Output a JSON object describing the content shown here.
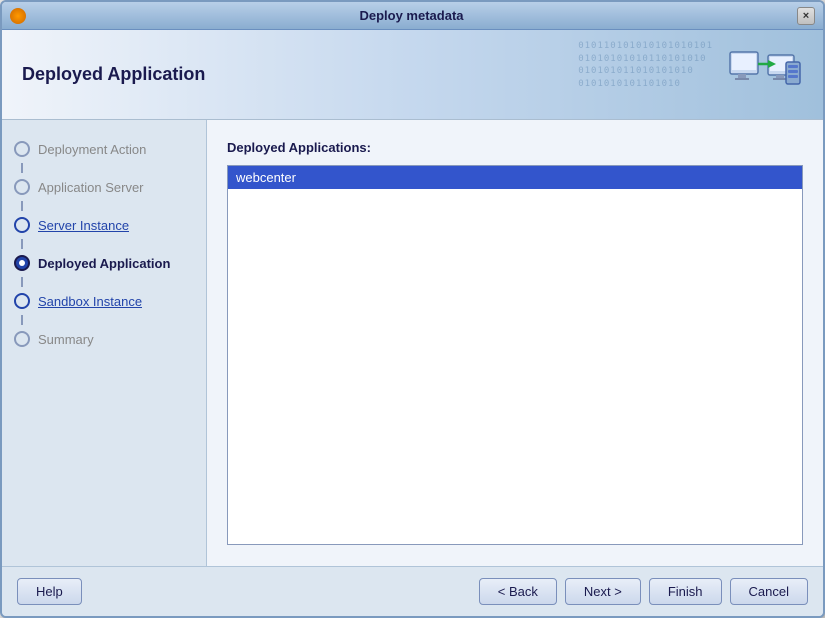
{
  "window": {
    "title": "Deploy metadata",
    "close_label": "×"
  },
  "header": {
    "title": "Deployed Application",
    "bg_text": "010110101010101010101\n01010101010110101010\n010101011010101010\n0101010101101010"
  },
  "sidebar": {
    "items": [
      {
        "id": "deployment-action",
        "label": "Deployment Action",
        "state": "disabled"
      },
      {
        "id": "application-server",
        "label": "Application Server",
        "state": "disabled"
      },
      {
        "id": "server-instance",
        "label": "Server Instance",
        "state": "link"
      },
      {
        "id": "deployed-application",
        "label": "Deployed Application",
        "state": "current"
      },
      {
        "id": "sandbox-instance",
        "label": "Sandbox Instance",
        "state": "link"
      },
      {
        "id": "summary",
        "label": "Summary",
        "state": "disabled"
      }
    ]
  },
  "content": {
    "section_label": "Deployed Applications:",
    "apps": [
      {
        "name": "webcenter",
        "selected": true
      }
    ]
  },
  "buttons": {
    "help": "Help",
    "back": "< Back",
    "next": "Next >",
    "finish": "Finish",
    "cancel": "Cancel"
  }
}
